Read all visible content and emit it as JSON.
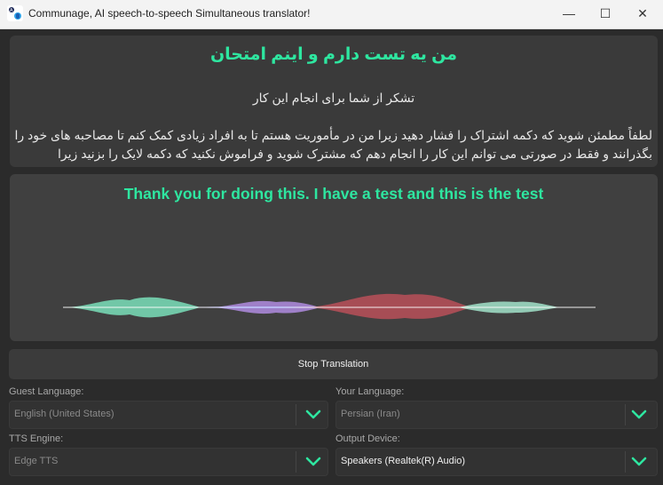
{
  "window": {
    "title": "Communage, AI speech-to-speech Simultaneous translator!",
    "min_glyph": "—",
    "max_glyph": "☐",
    "close_glyph": "✕"
  },
  "source": {
    "heading": "من یه تست دارم و اینم امتحان",
    "line1": "تشکر از شما برای انجام این کار",
    "body": "لطفاً مطمئن شوید که دکمه اشتراک را فشار دهید زیرا من در مأموریت هستم تا به افراد زیادی کمک کنم تا مصاحبه های خود را بگذرانند و فقط در صورتی می توانم این کار را انجام دهم که مشترک شوید و فراموش نکنید که دکمه لایک را بزنید زیرا"
  },
  "translation": {
    "text": "Thank you for doing this. I have a test and this is the test"
  },
  "controls": {
    "stop_label": "Stop Translation",
    "guest_language_label": "Guest Language:",
    "guest_language_value": "English (United States)",
    "your_language_label": "Your Language:",
    "your_language_value": "Persian (Iran)",
    "tts_engine_label": "TTS Engine:",
    "tts_engine_value": "Edge TTS",
    "output_device_label": "Output Device:",
    "output_device_value": "Speakers (Realtek(R) Audio)"
  },
  "colors": {
    "accent": "#2ee6a0",
    "wave_green": "#7de8c0",
    "wave_purple": "#b08ce0",
    "wave_red": "#c0505a",
    "wave_blue": "#7f7fe6"
  },
  "icons": {
    "app": "app-logo-icon",
    "dropdown": "chevron-down-icon"
  }
}
